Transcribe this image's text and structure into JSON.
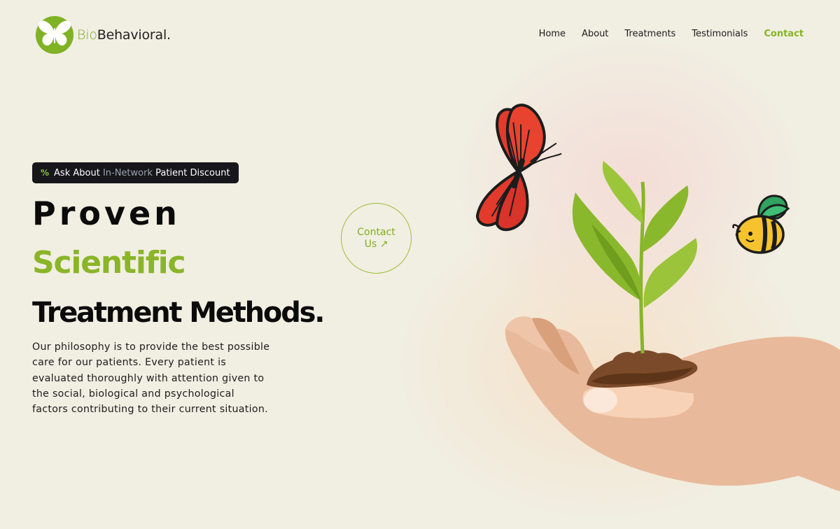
{
  "brand": {
    "name_bio": "Bio",
    "name_rest": "Behavioral.",
    "logo_icon": "butterfly-logo-icon"
  },
  "nav": {
    "items": [
      {
        "label": "Home"
      },
      {
        "label": "About"
      },
      {
        "label": "Treatments"
      },
      {
        "label": "Testimonials"
      },
      {
        "label": "Contact"
      }
    ],
    "active": "Contact"
  },
  "badge": {
    "icon": "percent-icon",
    "text_before": "Ask About ",
    "text_highlight": "In-Network",
    "text_after": " Patient Discount"
  },
  "hero": {
    "line1": "Proven",
    "line2": "Scientific",
    "line3": "Treatment Methods.",
    "description": "Our philosophy is to provide the best possible care for our patients. Every patient is evaluated thoroughly with attention given to the social, biological and psychological factors contributing to their current situation."
  },
  "cta": {
    "line1": "Contact",
    "line2": "Us",
    "icon": "arrow-up-right-icon"
  },
  "colors": {
    "accent": "#86b327",
    "background": "#f1eee2",
    "badge_bg": "#17171b"
  },
  "illustration": {
    "icons": [
      "butterfly-icon",
      "sprout-icon",
      "bee-icon",
      "hand-icon"
    ]
  }
}
